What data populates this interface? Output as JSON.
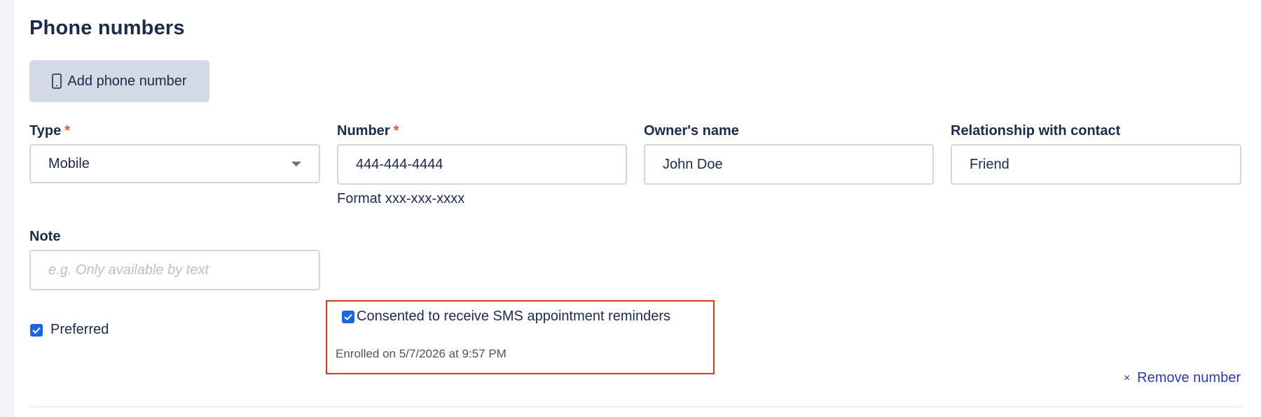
{
  "section": {
    "title": "Phone numbers",
    "add_button_label": "Add phone number"
  },
  "fields": {
    "type": {
      "label": "Type",
      "required_mark": "*",
      "value": "Mobile"
    },
    "number": {
      "label": "Number",
      "required_mark": "*",
      "value": "444-444-4444",
      "hint": "Format xxx-xxx-xxxx"
    },
    "owner": {
      "label": "Owner's name",
      "value": "John Doe"
    },
    "relationship": {
      "label": "Relationship with contact",
      "value": "Friend"
    },
    "note": {
      "label": "Note",
      "value": "",
      "placeholder": "e.g. Only available by text"
    }
  },
  "preferred": {
    "label": "Preferred",
    "checked": true
  },
  "consent": {
    "label": "Consented to receive SMS appointment reminders",
    "checked": true,
    "enrolled_text": "Enrolled on 5/7/2026 at 9:57 PM",
    "highlight_color": "#d93a1c"
  },
  "remove": {
    "icon": "×",
    "label": "Remove number"
  },
  "icons": {
    "add_button": "mobile-phone-icon",
    "checkbox": "checkmark-icon",
    "select": "chevron-down-icon",
    "remove": "close-icon"
  },
  "colors": {
    "accent": "#1a66e0",
    "text": "#1c2b4a",
    "link": "#2d3aa8",
    "required": "#d65b3e",
    "button_bg": "#d5dae7"
  }
}
